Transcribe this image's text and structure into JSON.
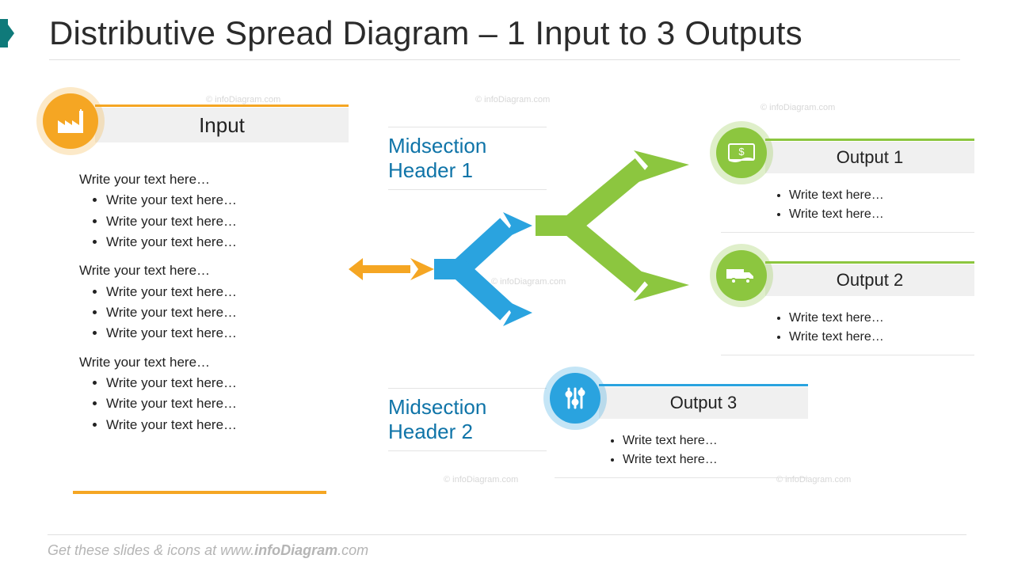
{
  "title": "Distributive Spread Diagram – 1 Input to 3 Outputs",
  "colors": {
    "orange": "#f5a623",
    "blue": "#2aa3df",
    "green": "#8cc63f",
    "teal": "#0f7a7a",
    "midtext": "#0f74a8"
  },
  "input": {
    "label": "Input",
    "icon": "factory-icon",
    "groups": [
      {
        "lead": "Write your text here…",
        "items": [
          "Write your text here…",
          "Write your text here…",
          "Write your text here…"
        ]
      },
      {
        "lead": "Write your text here…",
        "items": [
          "Write your text here…",
          "Write your text here…",
          "Write your text here…"
        ]
      },
      {
        "lead": "Write your text here…",
        "items": [
          "Write your text here…",
          "Write your text here…",
          "Write your text here…"
        ]
      }
    ]
  },
  "mid": {
    "h1": "Midsection Header 1",
    "h2": "Midsection Header 2"
  },
  "outputs": [
    {
      "label": "Output 1",
      "icon": "money-icon",
      "items": [
        "Write text here…",
        "Write text here…"
      ]
    },
    {
      "label": "Output 2",
      "icon": "truck-icon",
      "items": [
        "Write text here…",
        "Write text here…"
      ]
    },
    {
      "label": "Output 3",
      "icon": "sliders-icon",
      "items": [
        "Write text here…",
        "Write text here…"
      ]
    }
  ],
  "footer": {
    "prefix": "Get these slides & icons at www.",
    "bold": "infoDiagram",
    "suffix": ".com"
  },
  "watermark": "© infoDiagram.com"
}
